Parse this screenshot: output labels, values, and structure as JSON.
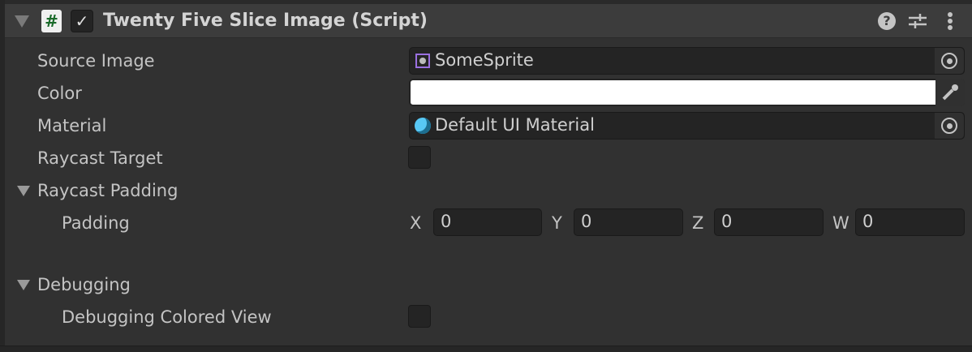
{
  "component": {
    "title": "Twenty Five Slice Image (Script)",
    "enabled": true,
    "script_icon_glyph": "#"
  },
  "fields": {
    "source_image": {
      "label": "Source Image",
      "value": "SomeSprite"
    },
    "color": {
      "label": "Color",
      "value": "#ffffff"
    },
    "material": {
      "label": "Material",
      "value": "Default UI Material"
    },
    "raycast_target": {
      "label": "Raycast Target",
      "checked": false
    },
    "raycast_padding": {
      "label": "Raycast Padding",
      "expanded": true
    },
    "padding": {
      "label": "Padding",
      "x_label": "X",
      "x": "0",
      "y_label": "Y",
      "y": "0",
      "z_label": "Z",
      "z": "0",
      "w_label": "W",
      "w": "0"
    },
    "debugging": {
      "label": "Debugging",
      "expanded": true
    },
    "debugging_colored_view": {
      "label": "Debugging Colored View",
      "checked": false
    }
  }
}
